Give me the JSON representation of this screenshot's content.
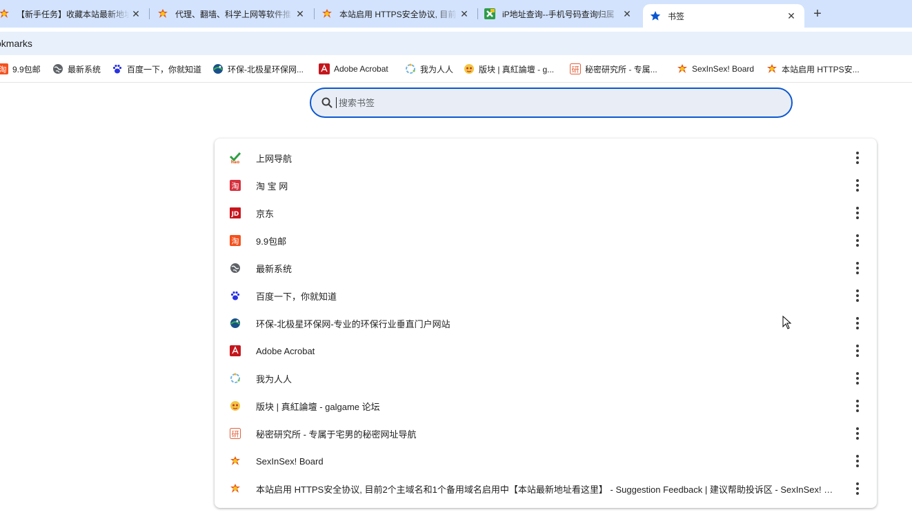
{
  "tabs": [
    {
      "title": "【新手任务】收藏本站最新地址",
      "icon": "sis-flame-icon",
      "active": false
    },
    {
      "title": "代理、翻墙、科学上网等软件推",
      "icon": "sis-flame-icon",
      "active": false
    },
    {
      "title": "本站启用 HTTPS安全协议, 目前",
      "icon": "sis-flame-icon",
      "active": false
    },
    {
      "title": "iP地址查询--手机号码查询归属",
      "icon": "ip-query-icon",
      "active": false
    },
    {
      "title": "书签",
      "icon": "star-icon",
      "active": true
    }
  ],
  "toolbar": {
    "page_label": "okmarks"
  },
  "bookmarks_bar": [
    {
      "label": "9.9包邮",
      "icon": "taobao-orange-icon"
    },
    {
      "label": "最新系统",
      "icon": "globe-icon"
    },
    {
      "label": "百度一下，你就知道",
      "icon": "baidu-paw-icon"
    },
    {
      "label": "环保-北极星环保网...",
      "icon": "bjx-globe-icon"
    },
    {
      "label": "Adobe Acrobat",
      "icon": "acrobat-icon"
    },
    {
      "label": "我为人人",
      "icon": "circle-dots-icon"
    },
    {
      "label": "版块 | 真紅論壇 - g...",
      "icon": "galgame-icon"
    },
    {
      "label": "秘密研究所 - 专属...",
      "icon": "yan-icon"
    },
    {
      "label": "SexInSex! Board",
      "icon": "sis-flame-icon"
    },
    {
      "label": "本站启用 HTTPS安...",
      "icon": "sis-flame-icon"
    }
  ],
  "search": {
    "placeholder": "搜索书签",
    "value": ""
  },
  "list": [
    {
      "label": "上网导航",
      "icon": "hao-check-icon"
    },
    {
      "label": "淘 宝 网",
      "icon": "taobao-icon"
    },
    {
      "label": "京东",
      "icon": "jd-icon"
    },
    {
      "label": "9.9包邮",
      "icon": "taobao-orange-icon"
    },
    {
      "label": "最新系统",
      "icon": "globe-icon"
    },
    {
      "label": "百度一下，你就知道",
      "icon": "baidu-paw-icon"
    },
    {
      "label": "环保-北极星环保网-专业的环保行业垂直门户网站",
      "icon": "bjx-globe-icon"
    },
    {
      "label": "Adobe Acrobat",
      "icon": "acrobat-icon"
    },
    {
      "label": "我为人人",
      "icon": "circle-dots-icon"
    },
    {
      "label": "版块 | 真紅論壇 - galgame 论坛",
      "icon": "galgame-icon"
    },
    {
      "label": "秘密研究所 - 专属于宅男的秘密网址导航",
      "icon": "yan-icon"
    },
    {
      "label": "SexInSex! Board",
      "icon": "sis-flame-icon"
    },
    {
      "label": "本站启用 HTTPS安全协议, 目前2个主域名和1个备用域名启用中【本站最新地址看这里】 - Suggestion Feedback | 建议帮助投诉区 - SexInSex! Bo...",
      "icon": "sis-flame-icon"
    }
  ],
  "colors": {
    "tabstrip": "#d3e3fd",
    "accent": "#0b57d0",
    "search_bg": "#e9eef6"
  }
}
